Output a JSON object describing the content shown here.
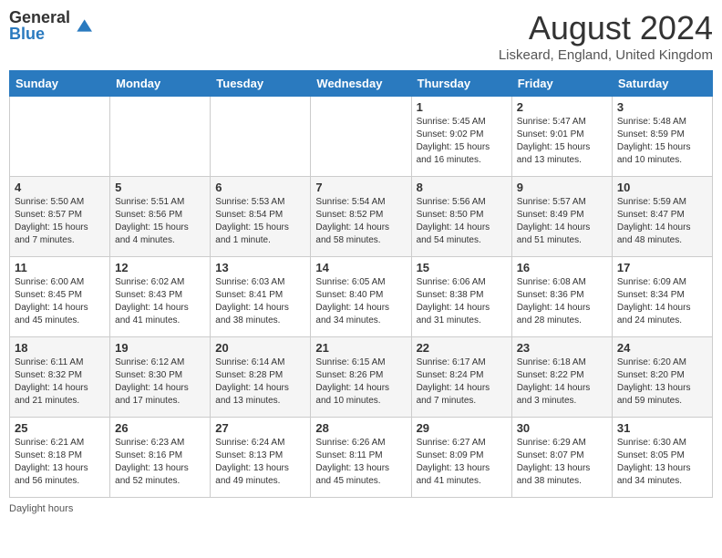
{
  "header": {
    "logo_general": "General",
    "logo_blue": "Blue",
    "month_title": "August 2024",
    "subtitle": "Liskeard, England, United Kingdom"
  },
  "days_of_week": [
    "Sunday",
    "Monday",
    "Tuesday",
    "Wednesday",
    "Thursday",
    "Friday",
    "Saturday"
  ],
  "weeks": [
    [
      {
        "day": "",
        "info": ""
      },
      {
        "day": "",
        "info": ""
      },
      {
        "day": "",
        "info": ""
      },
      {
        "day": "",
        "info": ""
      },
      {
        "day": "1",
        "info": "Sunrise: 5:45 AM\nSunset: 9:02 PM\nDaylight: 15 hours and 16 minutes."
      },
      {
        "day": "2",
        "info": "Sunrise: 5:47 AM\nSunset: 9:01 PM\nDaylight: 15 hours and 13 minutes."
      },
      {
        "day": "3",
        "info": "Sunrise: 5:48 AM\nSunset: 8:59 PM\nDaylight: 15 hours and 10 minutes."
      }
    ],
    [
      {
        "day": "4",
        "info": "Sunrise: 5:50 AM\nSunset: 8:57 PM\nDaylight: 15 hours and 7 minutes."
      },
      {
        "day": "5",
        "info": "Sunrise: 5:51 AM\nSunset: 8:56 PM\nDaylight: 15 hours and 4 minutes."
      },
      {
        "day": "6",
        "info": "Sunrise: 5:53 AM\nSunset: 8:54 PM\nDaylight: 15 hours and 1 minute."
      },
      {
        "day": "7",
        "info": "Sunrise: 5:54 AM\nSunset: 8:52 PM\nDaylight: 14 hours and 58 minutes."
      },
      {
        "day": "8",
        "info": "Sunrise: 5:56 AM\nSunset: 8:50 PM\nDaylight: 14 hours and 54 minutes."
      },
      {
        "day": "9",
        "info": "Sunrise: 5:57 AM\nSunset: 8:49 PM\nDaylight: 14 hours and 51 minutes."
      },
      {
        "day": "10",
        "info": "Sunrise: 5:59 AM\nSunset: 8:47 PM\nDaylight: 14 hours and 48 minutes."
      }
    ],
    [
      {
        "day": "11",
        "info": "Sunrise: 6:00 AM\nSunset: 8:45 PM\nDaylight: 14 hours and 45 minutes."
      },
      {
        "day": "12",
        "info": "Sunrise: 6:02 AM\nSunset: 8:43 PM\nDaylight: 14 hours and 41 minutes."
      },
      {
        "day": "13",
        "info": "Sunrise: 6:03 AM\nSunset: 8:41 PM\nDaylight: 14 hours and 38 minutes."
      },
      {
        "day": "14",
        "info": "Sunrise: 6:05 AM\nSunset: 8:40 PM\nDaylight: 14 hours and 34 minutes."
      },
      {
        "day": "15",
        "info": "Sunrise: 6:06 AM\nSunset: 8:38 PM\nDaylight: 14 hours and 31 minutes."
      },
      {
        "day": "16",
        "info": "Sunrise: 6:08 AM\nSunset: 8:36 PM\nDaylight: 14 hours and 28 minutes."
      },
      {
        "day": "17",
        "info": "Sunrise: 6:09 AM\nSunset: 8:34 PM\nDaylight: 14 hours and 24 minutes."
      }
    ],
    [
      {
        "day": "18",
        "info": "Sunrise: 6:11 AM\nSunset: 8:32 PM\nDaylight: 14 hours and 21 minutes."
      },
      {
        "day": "19",
        "info": "Sunrise: 6:12 AM\nSunset: 8:30 PM\nDaylight: 14 hours and 17 minutes."
      },
      {
        "day": "20",
        "info": "Sunrise: 6:14 AM\nSunset: 8:28 PM\nDaylight: 14 hours and 13 minutes."
      },
      {
        "day": "21",
        "info": "Sunrise: 6:15 AM\nSunset: 8:26 PM\nDaylight: 14 hours and 10 minutes."
      },
      {
        "day": "22",
        "info": "Sunrise: 6:17 AM\nSunset: 8:24 PM\nDaylight: 14 hours and 7 minutes."
      },
      {
        "day": "23",
        "info": "Sunrise: 6:18 AM\nSunset: 8:22 PM\nDaylight: 14 hours and 3 minutes."
      },
      {
        "day": "24",
        "info": "Sunrise: 6:20 AM\nSunset: 8:20 PM\nDaylight: 13 hours and 59 minutes."
      }
    ],
    [
      {
        "day": "25",
        "info": "Sunrise: 6:21 AM\nSunset: 8:18 PM\nDaylight: 13 hours and 56 minutes."
      },
      {
        "day": "26",
        "info": "Sunrise: 6:23 AM\nSunset: 8:16 PM\nDaylight: 13 hours and 52 minutes."
      },
      {
        "day": "27",
        "info": "Sunrise: 6:24 AM\nSunset: 8:13 PM\nDaylight: 13 hours and 49 minutes."
      },
      {
        "day": "28",
        "info": "Sunrise: 6:26 AM\nSunset: 8:11 PM\nDaylight: 13 hours and 45 minutes."
      },
      {
        "day": "29",
        "info": "Sunrise: 6:27 AM\nSunset: 8:09 PM\nDaylight: 13 hours and 41 minutes."
      },
      {
        "day": "30",
        "info": "Sunrise: 6:29 AM\nSunset: 8:07 PM\nDaylight: 13 hours and 38 minutes."
      },
      {
        "day": "31",
        "info": "Sunrise: 6:30 AM\nSunset: 8:05 PM\nDaylight: 13 hours and 34 minutes."
      }
    ]
  ],
  "footer": {
    "note": "Daylight hours"
  }
}
